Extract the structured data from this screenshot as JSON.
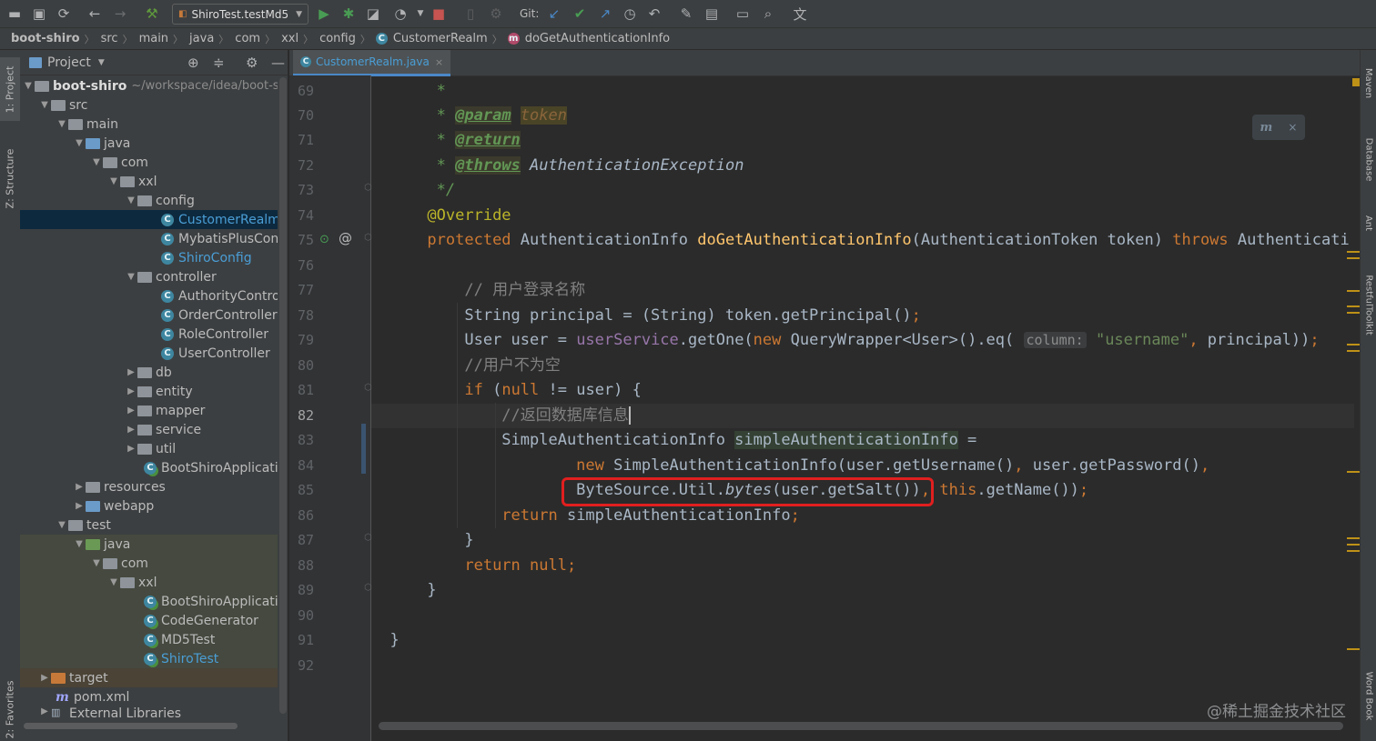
{
  "toolbar": {
    "run_config": "ShiroTest.testMd5",
    "git_label": "Git:",
    "icons": [
      "open-folder-icon",
      "save-icon",
      "sync-icon",
      "back-icon",
      "forward-icon",
      "build-hammer-icon",
      "run-icon",
      "debug-icon",
      "coverage-icon",
      "profile-icon",
      "stop-icon",
      "attach-icon",
      "stop-all-icon",
      "git-update-icon",
      "git-commit-icon",
      "git-push-icon",
      "history-icon",
      "rollback-icon",
      "settings-wrench-icon",
      "project-structure-icon",
      "terminal-frame-icon",
      "search-icon",
      "translate-icon"
    ]
  },
  "breadcrumb": [
    "boot-shiro",
    "src",
    "main",
    "java",
    "com",
    "xxl",
    "config",
    "CustomerRealm",
    "doGetAuthenticationInfo"
  ],
  "left_strip": {
    "tab1": "1: Project",
    "tab2": "Z: Structure",
    "tab3": "2: Favorites"
  },
  "right_strip": {
    "tab1": "Maven",
    "tab2": "Database",
    "tab3": "Ant",
    "tab4": "RestfulToolkit",
    "tab5": "Word Book"
  },
  "project_panel": {
    "title": "Project",
    "root_name": "boot-shiro",
    "root_path": "~/workspace/idea/boot-s",
    "tree": [
      {
        "label": "src"
      },
      {
        "label": "main"
      },
      {
        "label": "java"
      },
      {
        "label": "com"
      },
      {
        "label": "xxl"
      },
      {
        "label": "config"
      },
      {
        "label": "CustomerRealm"
      },
      {
        "label": "MybatisPlusCon"
      },
      {
        "label": "ShiroConfig"
      },
      {
        "label": "controller"
      },
      {
        "label": "AuthorityControl"
      },
      {
        "label": "OrderController"
      },
      {
        "label": "RoleController"
      },
      {
        "label": "UserController"
      },
      {
        "label": "db"
      },
      {
        "label": "entity"
      },
      {
        "label": "mapper"
      },
      {
        "label": "service"
      },
      {
        "label": "util"
      },
      {
        "label": "BootShiroApplicatic"
      },
      {
        "label": "resources"
      },
      {
        "label": "webapp"
      },
      {
        "label": "test"
      },
      {
        "label": "java"
      },
      {
        "label": "com"
      },
      {
        "label": "xxl"
      },
      {
        "label": "BootShiroApplicatic"
      },
      {
        "label": "CodeGenerator"
      },
      {
        "label": "MD5Test"
      },
      {
        "label": "ShiroTest"
      },
      {
        "label": "target"
      },
      {
        "label": "pom.xml"
      },
      {
        "label": "External Libraries"
      }
    ]
  },
  "editor": {
    "tab_label": "CustomerRealm.java",
    "line_numbers": [
      "69",
      "70",
      "71",
      "72",
      "73",
      "74",
      "75",
      "76",
      "77",
      "78",
      "79",
      "80",
      "81",
      "82",
      "83",
      "84",
      "85",
      "86",
      "87",
      "88",
      "89",
      "90",
      "91",
      "92"
    ],
    "current_line": "82",
    "code": {
      "l69_star": "*",
      "l70_star": "* ",
      "l70_tag": "@param",
      "l70_tok": "token",
      "l71_star": "* ",
      "l71_tag": "@return",
      "l72_star": "* ",
      "l72_tag": "@throws",
      "l72_text": " AuthenticationException",
      "l73": "*/",
      "l74": "@Override",
      "l75_kw": "protected",
      "l75_t1": " AuthenticationInfo ",
      "l75_fn": "doGetAuthenticationInfo",
      "l75_t2": "(AuthenticationToken token) ",
      "l75_kw2": "throws",
      "l75_t3": " Authenticati",
      "l77": "// 用户登录名称",
      "l78_t1": "String principal = (String) token.getPrincipal()",
      "l78_semi": ";",
      "l79_t1": "User user = ",
      "l79_fld": "userService",
      "l79_t2": ".getOne(",
      "l79_kw": "new",
      "l79_t3": " QueryWrapper<User>().eq( ",
      "l79_hint": "column:",
      "l79_str": " \"username\"",
      "l79_comma": ",",
      "l79_t4": " principal))",
      "l79_semi": ";",
      "l80": "//用户不为空",
      "l81_kw": "if",
      "l81_t1": " (",
      "l81_kw2": "null",
      "l81_t2": " != user) {",
      "l82": "//返回数据库信息",
      "l83_t1": "SimpleAuthenticationInfo ",
      "l83_var": "simpleAuthenticationInfo",
      "l83_t2": " =",
      "l84_kw": "new",
      "l84_t1": " SimpleAuthenticationInfo(user.getUsername()",
      "l84_c1": ",",
      "l84_t2": " user.getPassword()",
      "l84_c2": ",",
      "l85_t1": "ByteSource.Util.",
      "l85_it": "bytes",
      "l85_t2": "(user.getSalt())",
      "l85_c1": ",",
      "l85_kw": " this",
      "l85_t3": ".getName())",
      "l85_semi": ";",
      "l86_kw": "return",
      "l86_t1": " simpleAuthenticationInfo",
      "l86_semi": ";",
      "l87": "}",
      "l88_kw": "return",
      "l88_kw2": " null",
      "l88_semi": ";",
      "l89": "}",
      "l91": "}"
    }
  },
  "watermark": "@稀土掘金技术社区",
  "colors": {
    "accent": "#4a88c7",
    "highlight_box": "#e01f1f",
    "keyword": "#cc7832",
    "method": "#ffc66d",
    "doc_comment": "#629755"
  }
}
